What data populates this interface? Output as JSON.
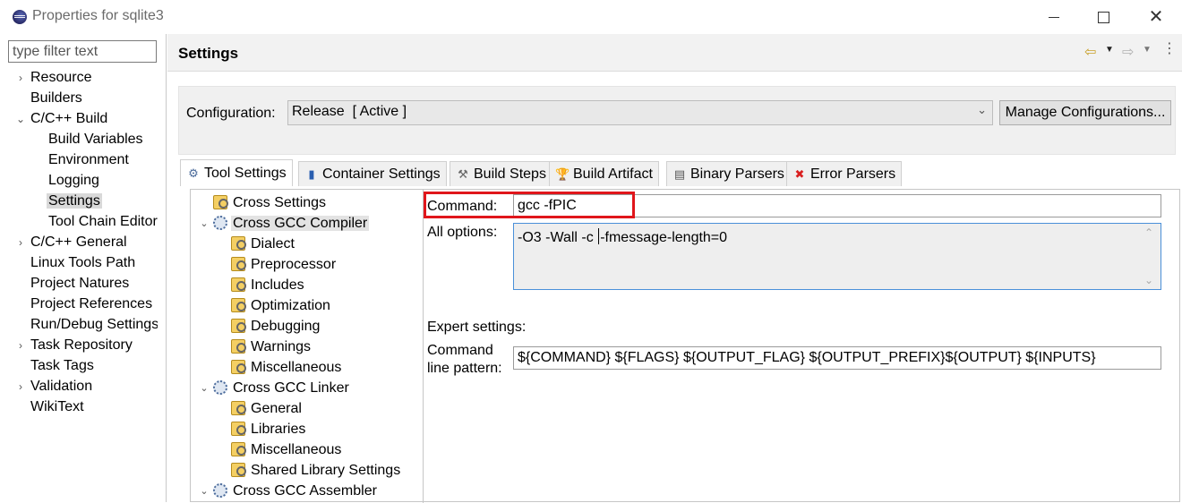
{
  "window": {
    "title": "Properties for sqlite3",
    "close_glyph": "✕"
  },
  "filter": {
    "placeholder": "type filter text"
  },
  "nav": [
    {
      "label": "Resource",
      "twisty": "›"
    },
    {
      "label": "Builders",
      "twisty": ""
    },
    {
      "label": "C/C++ Build",
      "twisty": "⌄"
    },
    {
      "label": "Build Variables",
      "twisty": ""
    },
    {
      "label": "Environment",
      "twisty": ""
    },
    {
      "label": "Logging",
      "twisty": ""
    },
    {
      "label": "Settings",
      "twisty": ""
    },
    {
      "label": "Tool Chain Editor",
      "twisty": ""
    },
    {
      "label": "C/C++ General",
      "twisty": "›"
    },
    {
      "label": "Linux Tools Path",
      "twisty": ""
    },
    {
      "label": "Project Natures",
      "twisty": ""
    },
    {
      "label": "Project References",
      "twisty": ""
    },
    {
      "label": "Run/Debug Settings",
      "twisty": ""
    },
    {
      "label": "Task Repository",
      "twisty": "›"
    },
    {
      "label": "Task Tags",
      "twisty": ""
    },
    {
      "label": "Validation",
      "twisty": "›"
    },
    {
      "label": "WikiText",
      "twisty": ""
    }
  ],
  "header": {
    "title": "Settings",
    "back_glyph": "⇦",
    "forward_glyph": "⇨",
    "dropdown_glyph": "▼",
    "menu_glyph": "⋮"
  },
  "config": {
    "label": "Configuration:",
    "value": "Release  [ Active ]",
    "caret": "⌄",
    "manage_button": "Manage Configurations..."
  },
  "tabs": [
    {
      "label": "Tool Settings",
      "icon": "⚙"
    },
    {
      "label": "Container Settings",
      "icon": "▮"
    },
    {
      "label": "Build Steps",
      "icon": "⚒"
    },
    {
      "label": "Build Artifact",
      "icon": "🏆"
    },
    {
      "label": "Binary Parsers",
      "icon": "▤"
    },
    {
      "label": "Error Parsers",
      "icon": "✖"
    }
  ],
  "tool_tree": [
    {
      "label": "Cross Settings",
      "icon": "folder",
      "twisty": ""
    },
    {
      "label": "Cross GCC Compiler",
      "icon": "gear",
      "twisty": "⌄"
    },
    {
      "label": "Dialect",
      "icon": "folder",
      "twisty": ""
    },
    {
      "label": "Preprocessor",
      "icon": "folder",
      "twisty": ""
    },
    {
      "label": "Includes",
      "icon": "folder",
      "twisty": ""
    },
    {
      "label": "Optimization",
      "icon": "folder",
      "twisty": ""
    },
    {
      "label": "Debugging",
      "icon": "folder",
      "twisty": ""
    },
    {
      "label": "Warnings",
      "icon": "folder",
      "twisty": ""
    },
    {
      "label": "Miscellaneous",
      "icon": "folder",
      "twisty": ""
    },
    {
      "label": "Cross GCC Linker",
      "icon": "gear",
      "twisty": "⌄"
    },
    {
      "label": "General",
      "icon": "folder",
      "twisty": ""
    },
    {
      "label": "Libraries",
      "icon": "folder",
      "twisty": ""
    },
    {
      "label": "Miscellaneous",
      "icon": "folder",
      "twisty": ""
    },
    {
      "label": "Shared Library Settings",
      "icon": "folder",
      "twisty": ""
    },
    {
      "label": "Cross GCC Assembler",
      "icon": "gear",
      "twisty": "⌄"
    }
  ],
  "form": {
    "command_label": "Command:",
    "command_value": "gcc -fPIC",
    "all_options_label": "All options:",
    "all_options_before_caret": "-O3 -Wall -c ",
    "all_options_after_caret": "-fmessage-length=0",
    "scroll_up": "⌃",
    "scroll_down": "⌄",
    "expert_label": "Expert settings:",
    "pattern_label_1": "Command",
    "pattern_label_2": "line pattern:",
    "pattern_value": "${COMMAND} ${FLAGS} ${OUTPUT_FLAG} ${OUTPUT_PREFIX}${OUTPUT} ${INPUTS}"
  },
  "colors": {
    "highlight": "#e0161b",
    "focus_border": "#4a90d9"
  }
}
